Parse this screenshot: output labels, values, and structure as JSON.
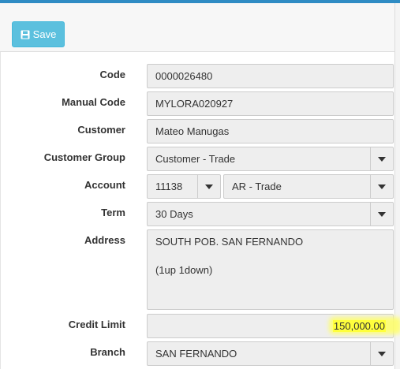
{
  "toolbar": {
    "save_label": "Save",
    "save_icon": "floppy-disk-icon"
  },
  "form": {
    "code": {
      "label": "Code",
      "value": "0000026480"
    },
    "manual_code": {
      "label": "Manual Code",
      "value": "MYLORA020927"
    },
    "customer": {
      "label": "Customer",
      "value": "Mateo Manugas"
    },
    "customer_group": {
      "label": "Customer Group",
      "value": "Customer - Trade"
    },
    "account": {
      "label": "Account",
      "number": "11138",
      "name": "AR - Trade"
    },
    "term": {
      "label": "Term",
      "value": "30 Days"
    },
    "address": {
      "label": "Address",
      "line1": "SOUTH POB. SAN FERNANDO",
      "line2": "",
      "line3": "(1up 1down)"
    },
    "credit_limit": {
      "label": "Credit Limit",
      "value": "150,000.00",
      "highlight_color": "#ffff3d"
    },
    "branch": {
      "label": "Branch",
      "value": "SAN FERNANDO"
    }
  },
  "colors": {
    "accent": "#2f8cc4",
    "save_button": "#5bc0de",
    "field_bg": "#eeeeee"
  }
}
